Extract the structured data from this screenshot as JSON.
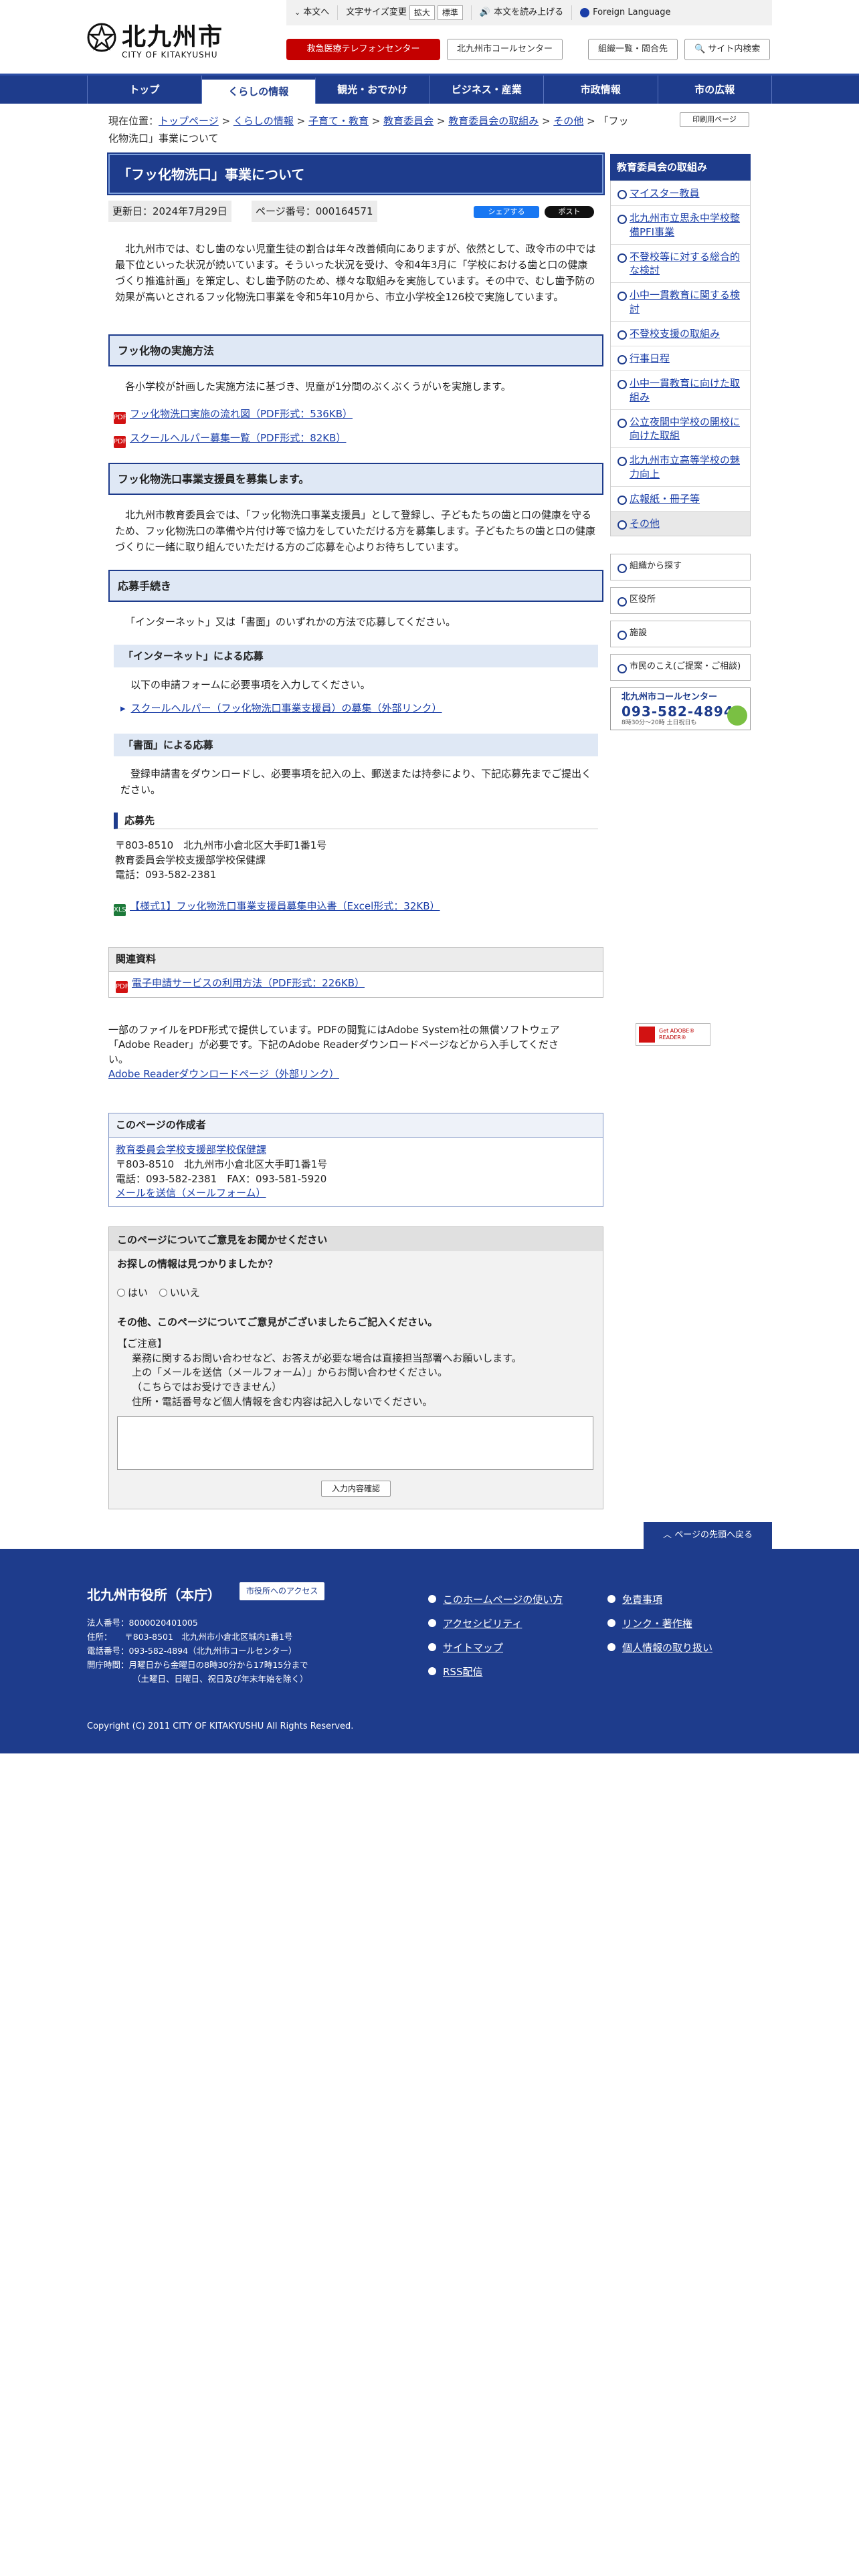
{
  "header": {
    "logo_title": "北九州市",
    "logo_sub": "CITY OF KITAKYUSHU",
    "util": {
      "skip_main": "本文へ",
      "font_size_label": "文字サイズ変更",
      "font_large": "拡大",
      "font_normal": "標準",
      "read_aloud": "本文を読み上げる",
      "foreign_language": "Foreign Language"
    },
    "buttons": {
      "emergency": "救急医療テレフォンセンター",
      "callcenter": "北九州市コールセンター",
      "org_contact": "組織一覧・問合先",
      "site_search": "サイト内検索"
    }
  },
  "nav": [
    "トップ",
    "くらしの情報",
    "観光・おでかけ",
    "ビジネス・産業",
    "市政情報",
    "市の広報"
  ],
  "breadcrumb": {
    "prefix": "現在位置：",
    "items": [
      "トップページ",
      "くらしの情報",
      "子育て・教育",
      "教育委員会",
      "教育委員会の取組み",
      "その他"
    ],
    "current": "「フッ化物洗口」事業について",
    "print": "印刷用ページ"
  },
  "page": {
    "title": "「フッ化物洗口」事業について",
    "updated": "更新日：2024年7月29日",
    "page_no": "ページ番号：000164571",
    "share_fb": "シェアする",
    "share_x": "ポスト",
    "intro": "北九州市では、むし歯のない児童生徒の割合は年々改善傾向にありますが、依然として、政令市の中では最下位といった状況が続いています。そういった状況を受け、令和4年3月に「学校における歯と口の健康づくり推進計画」を策定し、むし歯予防のため、様々な取組みを実施しています。その中で、むし歯予防の効果が高いとされるフッ化物洗口事業を令和5年10月から、市立小学校全126校で実施しています。"
  },
  "section1": {
    "heading": "フッ化物の実施方法",
    "text": "各小学校が計画した実施方法に基づき、児童が1分間のぶくぶくうがいを実施します。",
    "links": [
      "フッ化物洗口実施の流れ図（PDF形式：536KB）",
      "スクールヘルパー募集一覧（PDF形式：82KB）"
    ]
  },
  "section2": {
    "heading": "フッ化物洗口事業支援員を募集します。",
    "text": "北九州市教育委員会では、「フッ化物洗口事業支援員」として登録し、子どもたちの歯と口の健康を守るため、フッ化物洗口の準備や片付け等で協力をしていただける方を募集します。子どもたちの歯と口の健康づくりに一緒に取り組んでいただける方のご応募を心よりお待ちしています。"
  },
  "section3": {
    "heading": "応募手続き",
    "text": "「インターネット」又は「書面」のいずれかの方法で応募してください。",
    "internet": {
      "heading": "「インターネット」による応募",
      "text": "以下の申請フォームに必要事項を入力してください。",
      "link": "スクールヘルパー（フッ化物洗口事業支援員）の募集（外部リンク）"
    },
    "paper": {
      "heading": "「書面」による応募",
      "text": "登録申請書をダウンロードし、必要事項を記入の上、郵送または持参により、下記応募先までご提出ください。",
      "dest_heading": "応募先",
      "dest_lines": [
        "〒803-8510　北九州市小倉北区大手町1番1号",
        "教育委員会学校支援部学校保健課",
        "電話：093-582-2381"
      ],
      "excel_link": "【様式1】フッ化物洗口事業支援員募集申込書（Excel形式：32KB）"
    }
  },
  "related": {
    "heading": "関連資料",
    "link": "電子申請サービスの利用方法（PDF形式：226KB）"
  },
  "adobe": {
    "text": "一部のファイルをPDF形式で提供しています。PDFの閲覧にはAdobe System社の無償ソフトウェア「Adobe Reader」が必要です。下記のAdobe Readerダウンロードページなどから入手してください。",
    "link": "Adobe Readerダウンロードページ（外部リンク）",
    "badge": "Get ADOBE® READER®"
  },
  "author": {
    "heading": "このページの作成者",
    "dept": "教育委員会学校支援部学校保健課",
    "address": "〒803-8510　北九州市小倉北区大手町1番1号",
    "phone": "電話：093-582-2381　FAX：093-581-5920",
    "mail": "メールを送信（メールフォーム）"
  },
  "feedback": {
    "heading": "このページについてご意見をお聞かせください",
    "q1": "お探しの情報は見つかりましたか？",
    "yes": "はい",
    "no": "いいえ",
    "q2": "その他、このページについてご意見がございましたらご記入ください。",
    "notes": [
      "【ご注意】",
      "業務に関するお問い合わせなど、お答えが必要な場合は直接担当部署へお願いします。",
      "上の「メールを送信（メールフォーム）」からお問い合わせください。",
      "（こちらではお受けできません）",
      "住所・電話番号など個人情報を含む内容は記入しないでください。"
    ],
    "submit": "入力内容確認"
  },
  "sidebar": {
    "title": "教育委員会の取組み",
    "items": [
      "マイスター教員",
      "北九州市立思永中学校整備PFI事業",
      "不登校等に対する総合的な検討",
      "小中一貫教育に関する検討",
      "不登校支援の取組み",
      "行事日程",
      "小中一貫教育に向けた取組み",
      "公立夜間中学校の開校に向けた取組",
      "北九州市立高等学校の魅力向上",
      "広報紙・冊子等",
      "その他"
    ],
    "nav": [
      "組織から探す",
      "区役所",
      "施設",
      "市民のこえ(ご提案・ご相談)"
    ],
    "callcenter": {
      "name": "北九州市コールセンター",
      "tel": "093-582-4894",
      "hours": "8時30分〜20時 土日祝日も"
    }
  },
  "pagetop": "ページの先頭へ戻る",
  "footer": {
    "name": "北九州市役所（本庁）",
    "access": "市役所へのアクセス",
    "lines": [
      "法人番号：8000020401005",
      "住所：　　〒803-8501　北九州市小倉北区城内1番1号",
      "電話番号：093-582-4894（北九州市コールセンター）",
      "開庁時間：月曜日から金曜日の8時30分から17時15分まで",
      "（土曜日、日曜日、祝日及び年末年始を除く）"
    ],
    "links_col1": [
      "このホームページの使い方",
      "アクセシビリティ",
      "サイトマップ",
      "RSS配信"
    ],
    "links_col2": [
      "免責事項",
      "リンク・著作権",
      "個人情報の取り扱い"
    ],
    "copyright": "Copyright (C) 2011 CITY OF KITAKYUSHU All Rights Reserved."
  }
}
